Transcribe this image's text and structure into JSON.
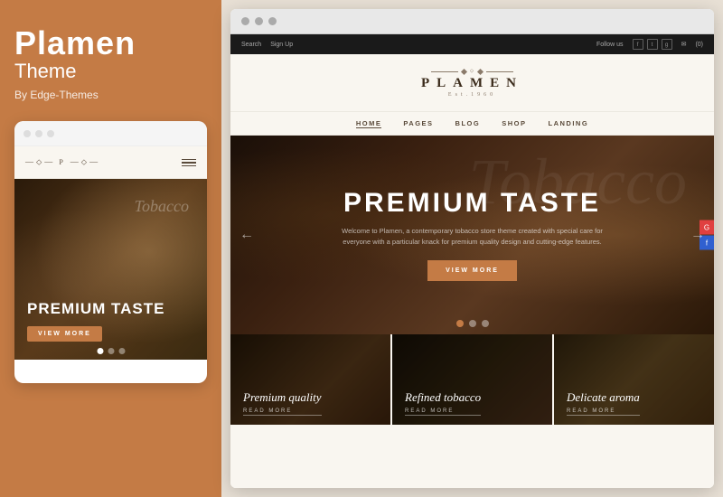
{
  "left": {
    "brand_title": "Plamen",
    "brand_subtitle": "Theme",
    "brand_by": "By Edge-Themes",
    "mobile_hero_title": "PREMIUM TASTE",
    "mobile_btn_label": "VIEW MORE",
    "dots": [
      "active",
      "inactive",
      "inactive"
    ]
  },
  "right": {
    "browser_dots": [
      "●",
      "●",
      "●"
    ],
    "site": {
      "topbar": {
        "search_label": "Search",
        "signup_label": "Sign Up",
        "follow_label": "Follow us",
        "cart_label": "(0)"
      },
      "logo": {
        "main": "PLAMEN",
        "est": "Est.1960",
        "ornament_left": "❖",
        "ornament_right": "❖"
      },
      "nav_items": [
        {
          "label": "HOME",
          "active": true
        },
        {
          "label": "PAGES",
          "active": false
        },
        {
          "label": "BLOG",
          "active": false
        },
        {
          "label": "SHOP",
          "active": false
        },
        {
          "label": "LANDING",
          "active": false
        }
      ],
      "hero": {
        "bg_italic": "Tobacco",
        "title": "PREMIUM TASTE",
        "desc": "Welcome to Plamen, a contemporary tobacco store theme created with special care for everyone with a particular knack for premium quality design and cutting-edge features.",
        "btn_label": "VIEW MORE",
        "dots": [
          "active",
          "inactive",
          "inactive"
        ]
      },
      "cards": [
        {
          "title": "Premium quality",
          "read_more": "READ MORE",
          "bg_class": "card1-bg"
        },
        {
          "title": "Refined tobacco",
          "read_more": "READ MORE",
          "bg_class": "card2-bg"
        },
        {
          "title": "Delicate aroma",
          "read_more": "READ MORE",
          "bg_class": "card3-bg"
        }
      ]
    }
  }
}
